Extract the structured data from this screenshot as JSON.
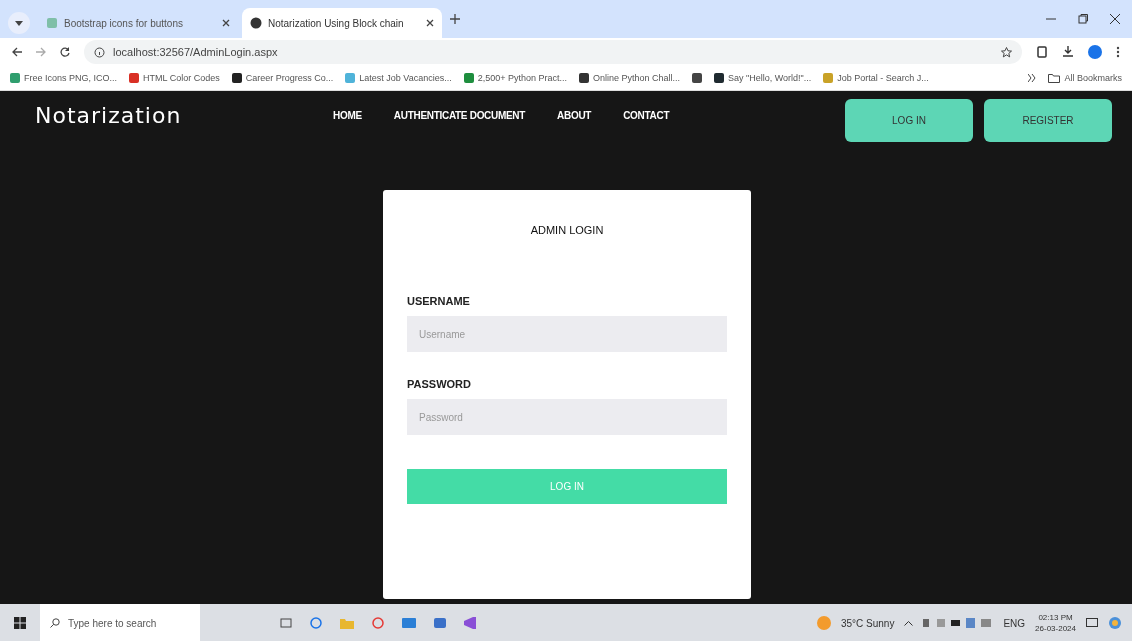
{
  "browser": {
    "tabs": [
      {
        "title": "Bootstrap icons for buttons",
        "selected": false
      },
      {
        "title": "Notarization Using Block chain",
        "selected": true
      }
    ],
    "address": "localhost:32567/AdminLogin.aspx",
    "bookmarks": [
      {
        "label": "Free Icons PNG, ICO...",
        "color": "#2f9e6e"
      },
      {
        "label": "HTML Color Codes",
        "color": "#d93025"
      },
      {
        "label": "Career Progress Co...",
        "color": "#222222"
      },
      {
        "label": "Latest Job Vacancies...",
        "color": "#4fb3d9"
      },
      {
        "label": "2,500+ Python Pract...",
        "color": "#1e8e3e"
      },
      {
        "label": "Online Python Chall...",
        "color": "#333333"
      },
      {
        "color": "#444444"
      },
      {
        "label": "Say \"Hello, World!\"...",
        "color": "#1f2a30"
      },
      {
        "label": "Job Portal - Search J...",
        "color": "#c9a227"
      }
    ],
    "all_bookmarks": "All Bookmarks"
  },
  "site": {
    "brand": "Notarization",
    "nav": [
      "HOME",
      "AUTHENTICATE DOCUMENT",
      "ABOUT",
      "CONTACT"
    ],
    "actions": [
      "LOG IN",
      "REGISTER"
    ]
  },
  "login": {
    "title": "ADMIN LOGIN",
    "fields": [
      {
        "label": "USERNAME",
        "placeholder": "Username"
      },
      {
        "label": "PASSWORD",
        "placeholder": "Password"
      }
    ],
    "submit": "LOG IN"
  },
  "taskbar": {
    "search_placeholder": "Type here to search",
    "weather": "35°C Sunny",
    "language": "ENG",
    "time": "02:13 PM",
    "date": "26-03-2024"
  }
}
